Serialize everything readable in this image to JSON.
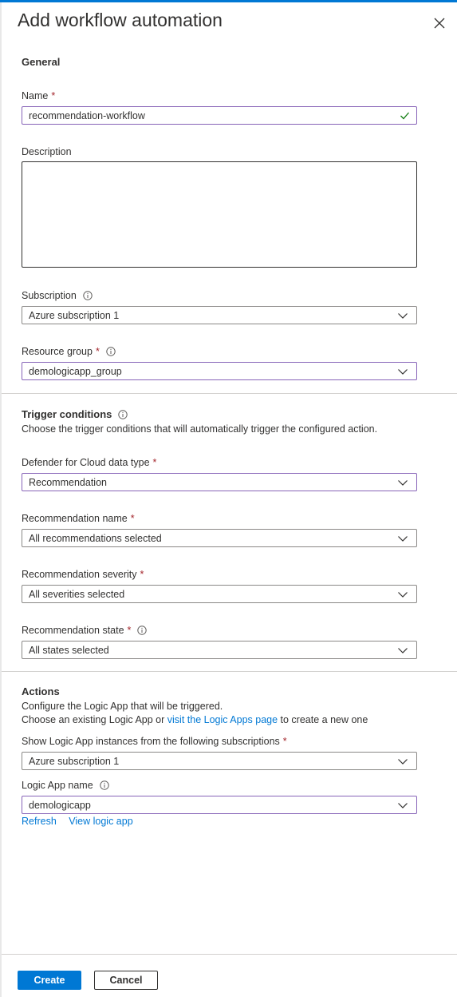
{
  "panel": {
    "title": "Add workflow automation"
  },
  "general": {
    "heading": "General",
    "name_label": "Name",
    "name_value": "recommendation-workflow",
    "description_label": "Description",
    "subscription_label": "Subscription",
    "subscription_value": "Azure subscription 1",
    "resource_group_label": "Resource group",
    "resource_group_value": "demologicapp_group"
  },
  "trigger": {
    "heading": "Trigger conditions",
    "description": "Choose the trigger conditions that will automatically trigger the configured action.",
    "data_type_label": "Defender for Cloud data type",
    "data_type_value": "Recommendation",
    "rec_name_label": "Recommendation name",
    "rec_name_value": "All recommendations selected",
    "rec_severity_label": "Recommendation severity",
    "rec_severity_value": "All severities selected",
    "rec_state_label": "Recommendation state",
    "rec_state_value": "All states selected"
  },
  "actions": {
    "heading": "Actions",
    "line1": "Configure the Logic App that will be triggered.",
    "line2_prefix": "Choose an existing Logic App or ",
    "line2_link": "visit the Logic Apps page",
    "line2_suffix": " to create a new one",
    "subs_label": "Show Logic App instances from the following subscriptions",
    "subs_value": "Azure subscription 1",
    "logic_app_label": "Logic App name",
    "logic_app_value": "demologicapp",
    "refresh_link": "Refresh",
    "view_link": "View logic app"
  },
  "footer": {
    "create_label": "Create",
    "cancel_label": "Cancel"
  },
  "colors": {
    "accent": "#0078d4",
    "focus_border": "#8764b8",
    "required": "#a4262c",
    "valid": "#107c10"
  }
}
